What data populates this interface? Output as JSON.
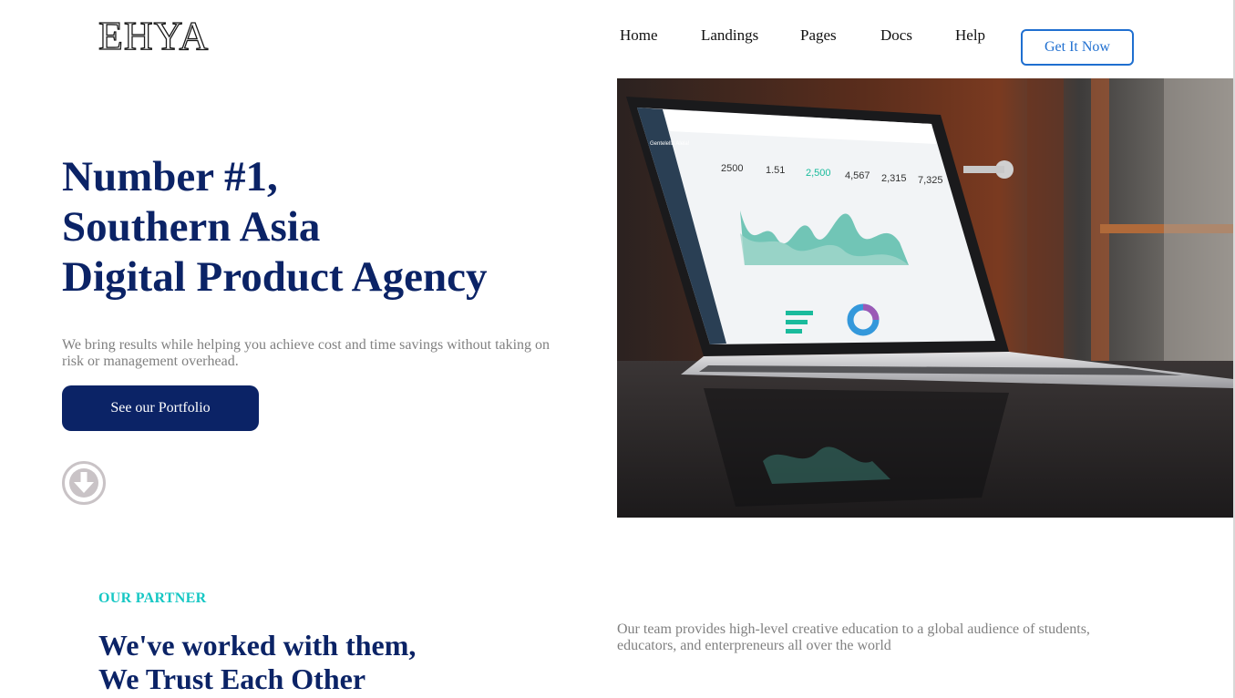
{
  "brand": {
    "logo_text": "EHYA"
  },
  "nav": {
    "items": [
      {
        "label": "Home"
      },
      {
        "label": "Landings"
      },
      {
        "label": "Pages"
      },
      {
        "label": "Docs"
      },
      {
        "label": "Help"
      }
    ],
    "cta_label": "Get It Now"
  },
  "hero": {
    "title_lines": [
      "Number #1,",
      "Southern Asia",
      "Digital Product Agency"
    ],
    "subtitle": "We bring results while helping you achieve cost and time savings without taking on risk or management overhead.",
    "button_label": "See our Portfolio",
    "image": {
      "dashboard_title": "Gentelella Alela!",
      "stats": [
        "2500",
        "1.51",
        "2,500",
        "4,567",
        "2,315",
        "7,325"
      ]
    }
  },
  "partner": {
    "eyebrow": "OUR PARTNER",
    "title_lines": [
      "We've worked with them,",
      "We Trust Each Other"
    ],
    "description": "Our team provides high-level creative education to a global audience of students, educators, and enterpreneurs all over the world"
  },
  "colors": {
    "primary": "#0b2366",
    "accent": "#1f6fd0",
    "teal": "#16c7c4",
    "muted_text": "#808080"
  }
}
